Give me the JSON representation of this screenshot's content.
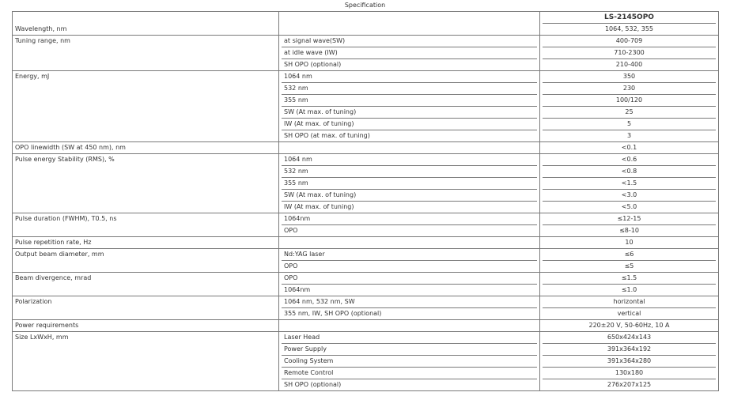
{
  "caption": "Specification",
  "header": {
    "model": "LS-2145OPO",
    "wavelength_label": "Wavelength, nm",
    "wavelength_value": "1064, 532, 355"
  },
  "rows": [
    {
      "param": "Tuning range, nm",
      "subs": [
        "at signal wave(SW)",
        "at idle wave (IW)",
        "SH OPO (optional)"
      ],
      "vals": [
        "400-709",
        "710-2300",
        "210-400"
      ]
    },
    {
      "param": "Energy, mJ",
      "subs": [
        "1064 nm",
        "532 nm",
        "355 nm",
        "SW (At max. of tuning)",
        "IW (At max. of tuning)",
        "SH OPO (at max. of tuning)"
      ],
      "vals": [
        "350",
        "230",
        "100/120",
        "25",
        "5",
        "3"
      ]
    },
    {
      "param": "OPO linewidth (SW at 450 nm), nm",
      "subs": [
        ""
      ],
      "vals": [
        "<0.1"
      ]
    },
    {
      "param": "Pulse energy Stability (RMS), %",
      "subs": [
        "1064 nm",
        "532 nm",
        "355 nm",
        "SW (At max. of tuning)",
        "IW (At max. of tuning)"
      ],
      "vals": [
        "<0.6",
        "<0.8",
        "<1.5",
        "<3.0",
        "<5.0"
      ]
    },
    {
      "param": "Pulse duration (FWHM), T0.5, ns",
      "subs": [
        "1064nm",
        "OPO"
      ],
      "vals": [
        "≤12-15",
        "≤8-10"
      ]
    },
    {
      "param": "Pulse repetition rate, Hz",
      "subs": [
        ""
      ],
      "vals": [
        "10"
      ]
    },
    {
      "param": "Output beam diameter, mm",
      "subs": [
        "Nd:YAG laser",
        "OPO"
      ],
      "vals": [
        "≤6",
        "≤5"
      ]
    },
    {
      "param": "Beam divergence, mrad",
      "subs": [
        "OPO",
        "1064nm"
      ],
      "vals": [
        "≤1.5",
        "≤1.0"
      ]
    },
    {
      "param": "Polarization",
      "subs": [
        "1064 nm, 532 nm, SW",
        "355 nm, IW, SH OPO (optional)"
      ],
      "vals": [
        "horizontal",
        "vertical"
      ]
    },
    {
      "param": "Power requirements",
      "subs": [
        ""
      ],
      "vals": [
        "220±20 V, 50-60Hz, 10 A"
      ]
    },
    {
      "param": "Size LxWxH, mm",
      "subs": [
        "Laser Head",
        "Power Supply",
        "Cooling System",
        "Remote Control",
        "SH OPO (optional)"
      ],
      "vals": [
        "650x424x143",
        "391x364x192",
        "391x364x280",
        "130x180",
        "276x207x125"
      ]
    }
  ]
}
